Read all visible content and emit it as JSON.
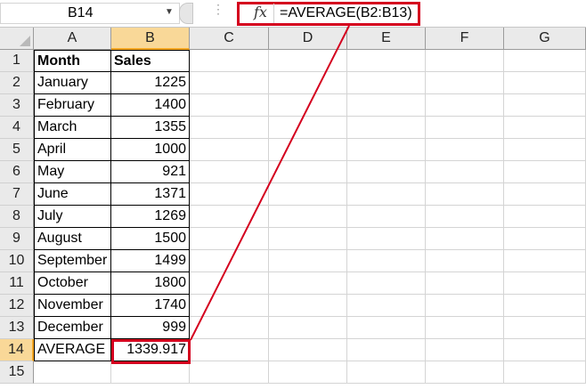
{
  "formula_bar": {
    "name_box": "B14",
    "dropdown_icon": "chevron-down-icon",
    "fx_label": "fx",
    "formula": "=AVERAGE(B2:B13)"
  },
  "columns": [
    "A",
    "B",
    "C",
    "D",
    "E",
    "F",
    "G"
  ],
  "rows": [
    "1",
    "2",
    "3",
    "4",
    "5",
    "6",
    "7",
    "8",
    "9",
    "10",
    "11",
    "12",
    "13",
    "14",
    "15"
  ],
  "active_cell": "B14",
  "highlight_color": "#d4001e",
  "table": {
    "headers": [
      "Month",
      "Sales"
    ],
    "records": [
      [
        "January",
        "1225"
      ],
      [
        "February",
        "1400"
      ],
      [
        "March",
        "1355"
      ],
      [
        "April",
        "1000"
      ],
      [
        "May",
        "921"
      ],
      [
        "June",
        "1371"
      ],
      [
        "July",
        "1269"
      ],
      [
        "August",
        "1500"
      ],
      [
        "September",
        "1499"
      ],
      [
        "October",
        "1800"
      ],
      [
        "November",
        "1740"
      ],
      [
        "December",
        "999"
      ]
    ],
    "summary": [
      "AVERAGE",
      "1339.917"
    ]
  }
}
